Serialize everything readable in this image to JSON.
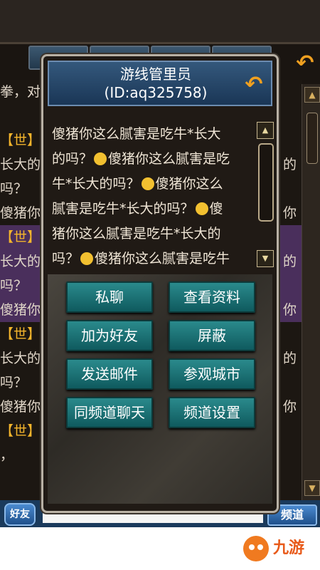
{
  "background_chat": {
    "lines": [
      {
        "text": "拳，对",
        "purple": false
      },
      {
        "text": "",
        "purple": false
      },
      {
        "text": "【世】",
        "purple": false
      },
      {
        "text": "长大的",
        "purple": false
      },
      {
        "text": "吗？",
        "purple": false
      },
      {
        "text": "傻猪你",
        "purple": false
      },
      {
        "text": "【世】",
        "purple": true
      },
      {
        "text": "长大的",
        "purple": true
      },
      {
        "text": "吗？",
        "purple": true
      },
      {
        "text": "傻猪你",
        "purple": true
      },
      {
        "text": "【世】",
        "purple": false
      },
      {
        "text": "长大的",
        "purple": false
      },
      {
        "text": "吗？",
        "purple": false
      },
      {
        "text": "傻猪你",
        "purple": false
      },
      {
        "text": "【世】",
        "purple": false
      },
      {
        "text": "，",
        "purple": false
      },
      {
        "text": "",
        "purple": false
      }
    ],
    "right_fragments": [
      "的",
      "你",
      "的",
      "你",
      "的",
      "你"
    ]
  },
  "bottom_bar": {
    "friend_label": "好友",
    "input_value": "",
    "channel_label": "频道"
  },
  "watermark": {
    "text": "九游"
  },
  "dialog": {
    "title": "游线管里员",
    "id_text": "(ID:aq325758)",
    "message_lines": [
      {
        "text": "傻猪你这么腻害是吃牛*长大",
        "emoji_after": false
      },
      {
        "text": "的吗？",
        "emoji_after": true,
        "tail": "傻猪你这么腻害是吃"
      },
      {
        "text": "牛*长大的吗？",
        "emoji_after": true,
        "tail": "傻猪你这么"
      },
      {
        "text": "腻害是吃牛*长大的吗？",
        "emoji_after": true,
        "tail": "傻"
      },
      {
        "text": "猪你这么腻害是吃牛*长大的",
        "emoji_after": false
      },
      {
        "text": "吗？",
        "emoji_after": true,
        "tail": "傻猪你这么腻害是吃牛"
      }
    ],
    "actions": [
      {
        "name": "private-chat-button",
        "label": "私聊"
      },
      {
        "name": "view-profile-button",
        "label": "查看资料"
      },
      {
        "name": "add-friend-button",
        "label": "加为好友"
      },
      {
        "name": "block-button",
        "label": "屏蔽"
      },
      {
        "name": "send-mail-button",
        "label": "发送邮件"
      },
      {
        "name": "visit-city-button",
        "label": "参观城市"
      },
      {
        "name": "same-channel-chat-button",
        "label": "同频道聊天"
      },
      {
        "name": "channel-settings-button",
        "label": "频道设置"
      }
    ]
  },
  "colors": {
    "accent_gold": "#f4b52c",
    "button_teal": "#1a7a7c",
    "header_blue": "#2a4a6e",
    "background_purple": "#4a2f5c"
  }
}
